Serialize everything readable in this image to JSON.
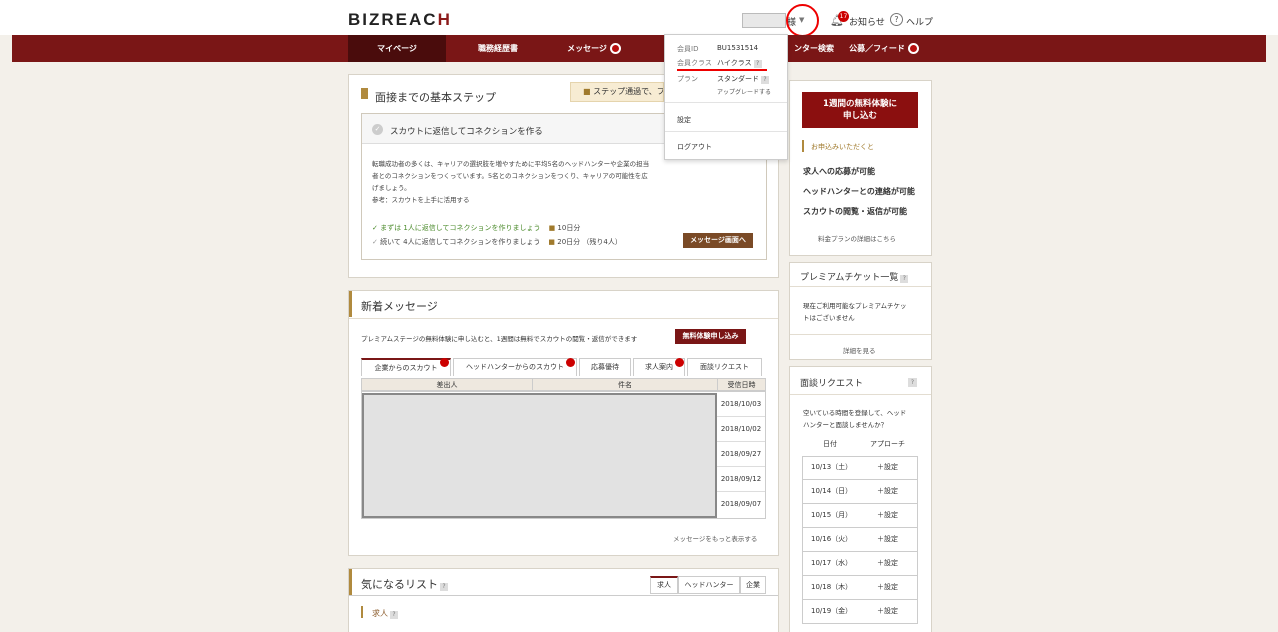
{
  "header": {
    "logo_main": "BIZREAC",
    "logo_mark": "H",
    "user_suffix": "様",
    "notice_badge": "17",
    "notice_label": "お知らせ",
    "help_label": "ヘルプ"
  },
  "nav": {
    "items": [
      {
        "label": "マイページ"
      },
      {
        "label": "職務経歴書"
      },
      {
        "label": "メッセージ"
      },
      {
        "label": "ンター検索"
      },
      {
        "label": "公募／フィード"
      }
    ]
  },
  "dropdown": {
    "member_id_label": "会員ID",
    "member_id_value": "BU1531514",
    "class_label": "会員クラス",
    "class_value": "ハイクラス",
    "plan_label": "プラン",
    "plan_value": "スタンダード",
    "upgrade": "アップグレードする",
    "settings": "設定",
    "logout": "ログアウト"
  },
  "steps": {
    "title": "面接までの基本ステップ",
    "ribbon": "ステップ通過で、フ",
    "box_title": "スカウトに返信してコネクションを作る",
    "body_line1": "転職成功者の多くは、キャリアの選択肢を増やすために平均5名のヘッドハンターや企業の担当",
    "body_line2": "者とのコネクションをつくっています。5名とのコネクションをつくり、キャリアの可能性を広",
    "body_line3": "げましょう。",
    "reference": "参考：スカウトを上手に活用する",
    "task1": "まずは 1人に返信してコネクションを作りましょう",
    "task1_reward": "10日分",
    "task2": "続いて 4人に返信してコネクションを作りましょう",
    "task2_reward": "20日分 （残り4人）",
    "button": "メッセージ画面へ"
  },
  "messages": {
    "title": "新着メッセージ",
    "promo": "プレミアムステージの無料体験に申し込むと、1週間は無料でスカウトの閲覧・返信ができます",
    "trial_button": "無料体験申し込み",
    "tabs": [
      "企業からのスカウト",
      "ヘッドハンターからのスカウト",
      "応募優待",
      "求人案内",
      "面談リクエスト"
    ],
    "columns": [
      "差出人",
      "件名",
      "受信日時"
    ],
    "dates": [
      "2018/10/03",
      "2018/10/02",
      "2018/09/27",
      "2018/09/12",
      "2018/09/07"
    ],
    "more": "メッセージをもっと表示する"
  },
  "watchlist": {
    "title": "気になるリスト",
    "tabs": [
      "求人",
      "ヘッドハンター",
      "企業"
    ],
    "section": "求人"
  },
  "sidebar": {
    "trial_button_line1": "1週間の無料体験に",
    "trial_button_line2": "申し込む",
    "benefits_label": "お申込みいただくと",
    "benefits": [
      "求人への応募が可能",
      "ヘッドハンターとの連絡が可能",
      "スカウトの閲覧・返信が可能"
    ],
    "plan_details": "料金プランの詳細はこちら",
    "tickets_title": "プレミアムチケット一覧",
    "tickets_text1": "現在ご利用可能なプレミアムチケッ",
    "tickets_text2": "トはございません",
    "tickets_more": "詳細を見る",
    "interview_title": "面談リクエスト",
    "interview_text1": "空いている時間を登録して、ヘッド",
    "interview_text2": "ハンターと面談しませんか？",
    "col_date": "日付",
    "col_approach": "アプローチ",
    "calendar": [
      {
        "date": "10/13（土）",
        "action": "＋設定"
      },
      {
        "date": "10/14（日）",
        "action": "＋設定"
      },
      {
        "date": "10/15（月）",
        "action": "＋設定"
      },
      {
        "date": "10/16（火）",
        "action": "＋設定"
      },
      {
        "date": "10/17（水）",
        "action": "＋設定"
      },
      {
        "date": "10/18（木）",
        "action": "＋設定"
      },
      {
        "date": "10/19（金）",
        "action": "＋設定"
      }
    ]
  },
  "colors": {
    "brand": "#7a1616",
    "annotation": "#e00000"
  }
}
